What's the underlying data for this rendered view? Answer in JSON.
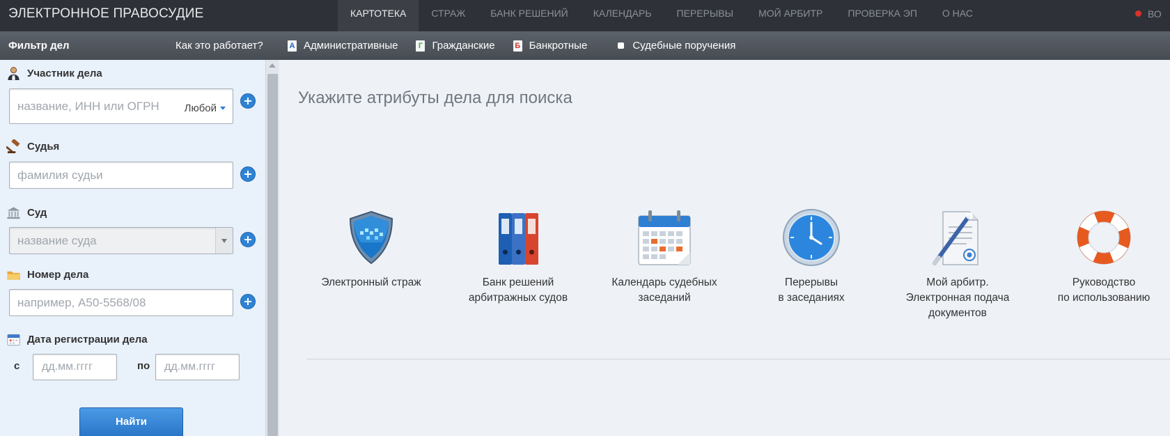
{
  "header": {
    "logo": "ЭЛЕКТРОННОЕ ПРАВОСУДИЕ",
    "nav": [
      "КАРТОТЕКА",
      "СТРАЖ",
      "БАНК РЕШЕНИЙ",
      "КАЛЕНДАРЬ",
      "ПЕРЕРЫВЫ",
      "МОЙ АРБИТР",
      "ПРОВЕРКА ЭП",
      "О НАС"
    ],
    "active_nav": "КАРТОТЕКА",
    "user_partial": "ВО"
  },
  "filter_bar": {
    "title": "Фильтр дел",
    "how": "Как это работает?",
    "types": [
      {
        "icon": "А",
        "label": "Административные"
      },
      {
        "icon": "Г",
        "label": "Гражданские"
      },
      {
        "icon": "Б",
        "label": "Банкротные"
      },
      {
        "icon": "",
        "label": "Судебные поручения"
      }
    ]
  },
  "sidebar": {
    "participant": {
      "label": "Участник дела",
      "placeholder": "название, ИНН или ОГРН",
      "mode": "Любой"
    },
    "judge": {
      "label": "Судья",
      "placeholder": "фамилия судьи"
    },
    "court": {
      "label": "Суд",
      "placeholder": "название суда"
    },
    "case_number": {
      "label": "Номер дела",
      "placeholder": "например, А50-5568/08"
    },
    "reg_date": {
      "label": "Дата регистрации дела",
      "from_label": "с",
      "to_label": "по",
      "from_placeholder": "дд.мм.гггг",
      "to_placeholder": "дд.мм.гггг"
    },
    "find_button": "Найти"
  },
  "main": {
    "title": "Укажите атрибуты дела для поиска",
    "tiles": [
      {
        "icon": "shield-icon",
        "line1": "Электронный страж",
        "line2": "",
        "line3": ""
      },
      {
        "icon": "binders-icon",
        "line1": "Банк решений",
        "line2": "арбитражных судов",
        "line3": ""
      },
      {
        "icon": "calendar-icon",
        "line1": "Календарь судебных",
        "line2": "заседаний",
        "line3": ""
      },
      {
        "icon": "clock-icon",
        "line1": "Перерывы",
        "line2": "в заседаниях",
        "line3": ""
      },
      {
        "icon": "document-pen-icon",
        "line1": "Мой арбитр.",
        "line2": "Электронная подача",
        "line3": "документов"
      },
      {
        "icon": "lifebuoy-icon",
        "line1": "Руководство",
        "line2": "по использованию",
        "line3": ""
      }
    ]
  },
  "colors": {
    "topbar": "#2e3238",
    "accent": "#2f83d4",
    "sidebar": "#e9f1fb"
  }
}
